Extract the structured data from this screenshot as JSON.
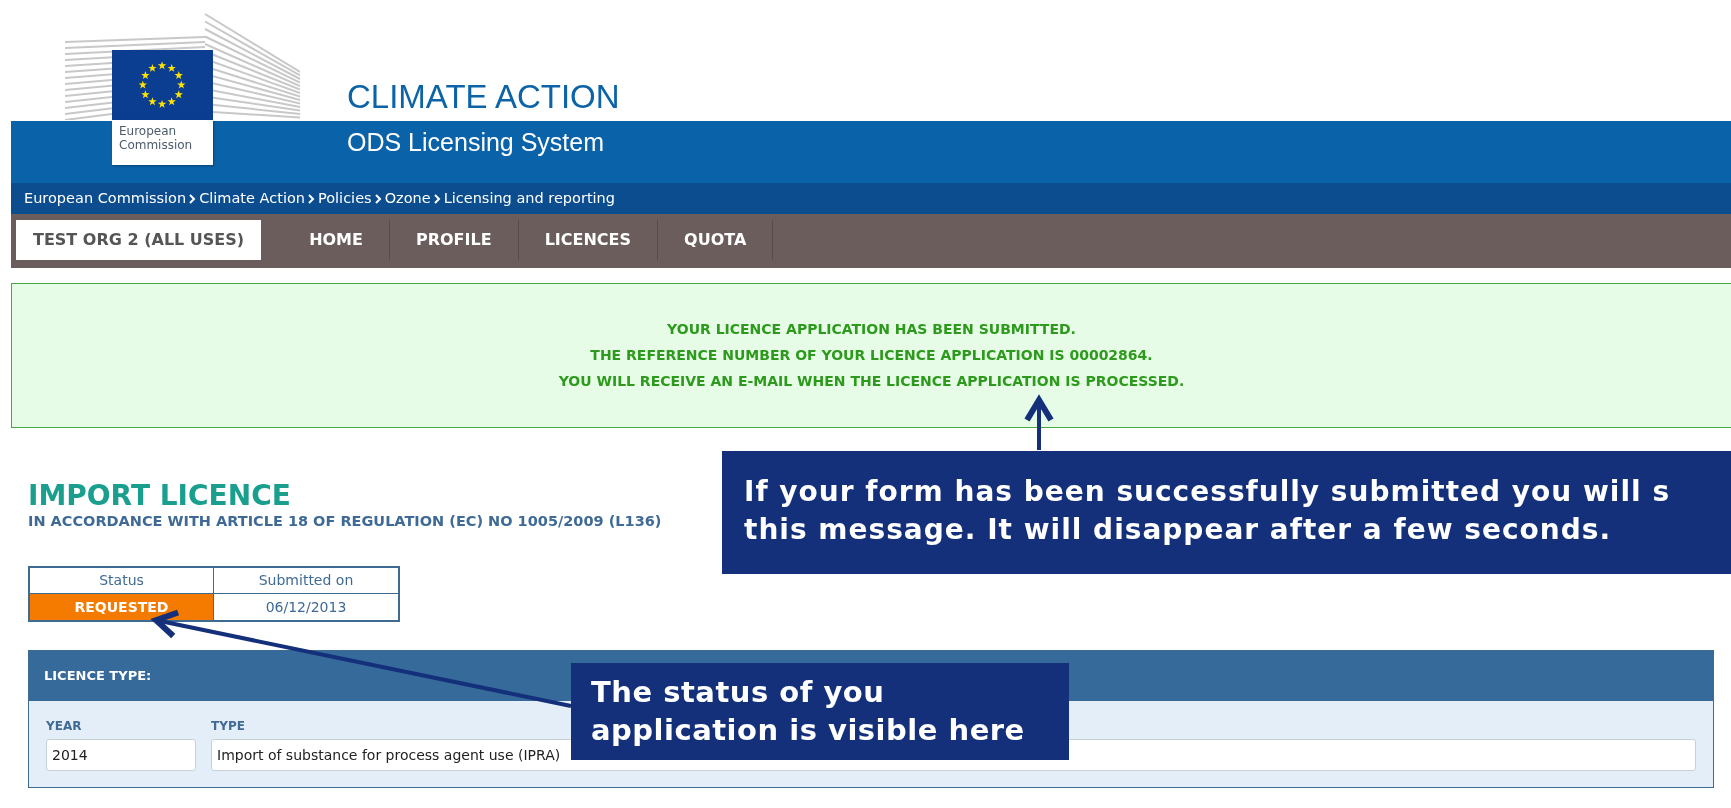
{
  "header": {
    "logo_text": "European Commission",
    "title": "CLIMATE ACTION",
    "subtitle": "ODS Licensing System"
  },
  "breadcrumb": [
    "European Commission",
    "Climate Action",
    "Policies",
    "Ozone",
    "Licensing and reporting"
  ],
  "nav": [
    {
      "label": "TEST ORG 2 (ALL USES)",
      "selected": true
    },
    {
      "label": "HOME",
      "selected": false
    },
    {
      "label": "PROFILE",
      "selected": false
    },
    {
      "label": "LICENCES",
      "selected": false
    },
    {
      "label": "QUOTA",
      "selected": false
    }
  ],
  "message": [
    "YOUR LICENCE APPLICATION HAS BEEN SUBMITTED.",
    "THE REFERENCE NUMBER OF YOUR LICENCE APPLICATION IS 00002864.",
    "YOU WILL RECEIVE AN E-MAIL WHEN THE LICENCE APPLICATION IS PROCESSED."
  ],
  "licence": {
    "title": "IMPORT LICENCE",
    "subtitle": "IN ACCORDANCE WITH ARTICLE 18 OF REGULATION (EC) NO 1005/2009 (L136)",
    "status_table": {
      "columns": [
        "Status",
        "Submitted on"
      ],
      "status": "REQUESTED",
      "submitted_on": "06/12/2013"
    },
    "licence_type": {
      "heading": "LICENCE TYPE:",
      "fields": [
        {
          "label": "YEAR",
          "value": "2014"
        },
        {
          "label": "TYPE",
          "value": "Import of substance for process agent use (IPRA)"
        }
      ]
    }
  },
  "callouts": [
    {
      "lines": [
        "If your form has been successfully submitted you will s",
        "this message. It will disappear after a few seconds."
      ]
    },
    {
      "lines": [
        "The status of you",
        "application is visible here"
      ]
    }
  ]
}
